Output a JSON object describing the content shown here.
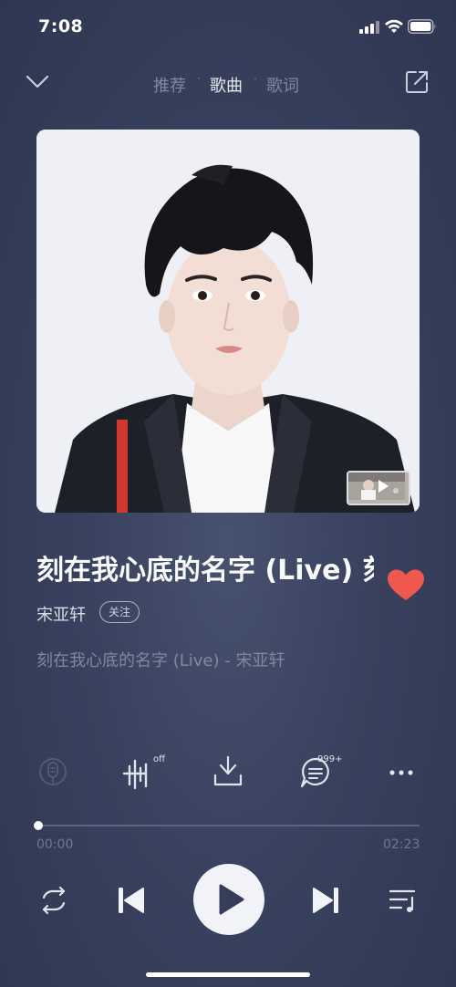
{
  "status_bar": {
    "time": "7:08"
  },
  "nav": {
    "tabs": [
      {
        "label": "推荐",
        "active": false
      },
      {
        "label": "歌曲",
        "active": true
      },
      {
        "label": "歌词",
        "active": false
      }
    ]
  },
  "song": {
    "title": "刻在我心底的名字 (Live) 刻",
    "artist": "宋亚轩",
    "follow_label": "关注",
    "lyric_line": "刻在我心底的名字 (Live) - 宋亚轩",
    "liked": true
  },
  "actions": {
    "sound_effect_badge": "off",
    "comment_badge": "999+"
  },
  "player": {
    "current_time": "00:00",
    "total_time": "02:23",
    "progress": 0
  },
  "colors": {
    "background": "#38415d",
    "heart": "#f0584f",
    "play_button": "#f2f3f8"
  }
}
